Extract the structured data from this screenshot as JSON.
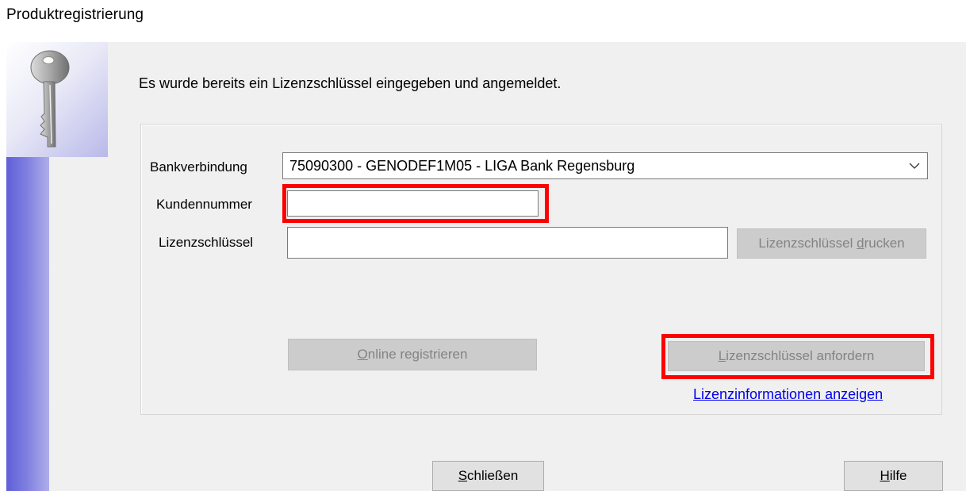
{
  "window": {
    "title": "Produktregistrierung"
  },
  "dialog": {
    "message": "Es wurde bereits ein Lizenzschlüssel eingegeben und angemeldet.",
    "icon": "key-icon"
  },
  "form": {
    "bank_label": "Bankverbindung",
    "bank_value": "75090300 - GENODEF1M05 - LIGA Bank Regensburg",
    "customer_label": "Kundennummer",
    "customer_value": "",
    "license_label": "Lizenzschlüssel",
    "license_value": ""
  },
  "buttons": {
    "print_key": {
      "prefix": "Lizenzschlüssel ",
      "mnemonic": "d",
      "suffix": "rucken",
      "enabled": false
    },
    "online_register": {
      "prefix": "",
      "mnemonic": "O",
      "suffix": "nline registrieren",
      "enabled": false
    },
    "request_key": {
      "prefix": "",
      "mnemonic": "L",
      "suffix": "izenzschlüssel anfordern",
      "enabled": false
    },
    "close": {
      "prefix": "",
      "mnemonic": "S",
      "suffix": "chließen",
      "enabled": true
    },
    "help": {
      "prefix": "",
      "mnemonic": "H",
      "suffix": "ilfe",
      "enabled": true
    }
  },
  "links": {
    "license_info": "Lizenzinformationen anzeigen"
  },
  "highlights": [
    "customer-number-field",
    "request-key-button"
  ],
  "colors": {
    "highlight": "#ff0000",
    "link": "#0000ee",
    "dialog_background": "#f0f0f0",
    "side_band": "#6b6bdb"
  }
}
